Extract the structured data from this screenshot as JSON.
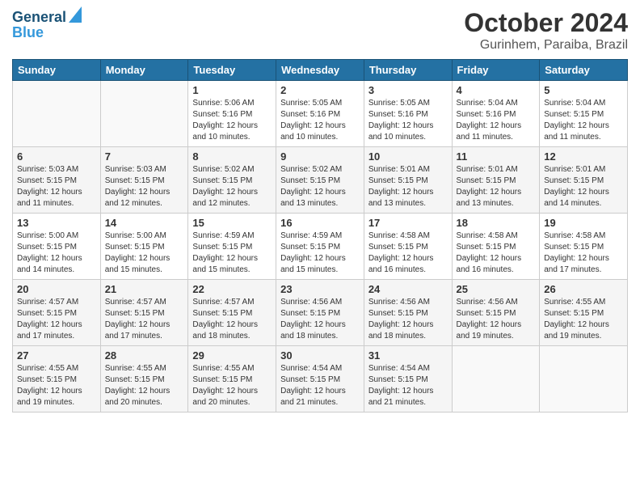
{
  "header": {
    "logo_line1": "General",
    "logo_line2": "Blue",
    "title": "October 2024",
    "subtitle": "Gurinhem, Paraiba, Brazil"
  },
  "days_of_week": [
    "Sunday",
    "Monday",
    "Tuesday",
    "Wednesday",
    "Thursday",
    "Friday",
    "Saturday"
  ],
  "weeks": [
    [
      {
        "day": "",
        "sunrise": "",
        "sunset": "",
        "daylight": ""
      },
      {
        "day": "",
        "sunrise": "",
        "sunset": "",
        "daylight": ""
      },
      {
        "day": "1",
        "sunrise": "Sunrise: 5:06 AM",
        "sunset": "Sunset: 5:16 PM",
        "daylight": "Daylight: 12 hours and 10 minutes."
      },
      {
        "day": "2",
        "sunrise": "Sunrise: 5:05 AM",
        "sunset": "Sunset: 5:16 PM",
        "daylight": "Daylight: 12 hours and 10 minutes."
      },
      {
        "day": "3",
        "sunrise": "Sunrise: 5:05 AM",
        "sunset": "Sunset: 5:16 PM",
        "daylight": "Daylight: 12 hours and 10 minutes."
      },
      {
        "day": "4",
        "sunrise": "Sunrise: 5:04 AM",
        "sunset": "Sunset: 5:16 PM",
        "daylight": "Daylight: 12 hours and 11 minutes."
      },
      {
        "day": "5",
        "sunrise": "Sunrise: 5:04 AM",
        "sunset": "Sunset: 5:15 PM",
        "daylight": "Daylight: 12 hours and 11 minutes."
      }
    ],
    [
      {
        "day": "6",
        "sunrise": "Sunrise: 5:03 AM",
        "sunset": "Sunset: 5:15 PM",
        "daylight": "Daylight: 12 hours and 11 minutes."
      },
      {
        "day": "7",
        "sunrise": "Sunrise: 5:03 AM",
        "sunset": "Sunset: 5:15 PM",
        "daylight": "Daylight: 12 hours and 12 minutes."
      },
      {
        "day": "8",
        "sunrise": "Sunrise: 5:02 AM",
        "sunset": "Sunset: 5:15 PM",
        "daylight": "Daylight: 12 hours and 12 minutes."
      },
      {
        "day": "9",
        "sunrise": "Sunrise: 5:02 AM",
        "sunset": "Sunset: 5:15 PM",
        "daylight": "Daylight: 12 hours and 13 minutes."
      },
      {
        "day": "10",
        "sunrise": "Sunrise: 5:01 AM",
        "sunset": "Sunset: 5:15 PM",
        "daylight": "Daylight: 12 hours and 13 minutes."
      },
      {
        "day": "11",
        "sunrise": "Sunrise: 5:01 AM",
        "sunset": "Sunset: 5:15 PM",
        "daylight": "Daylight: 12 hours and 13 minutes."
      },
      {
        "day": "12",
        "sunrise": "Sunrise: 5:01 AM",
        "sunset": "Sunset: 5:15 PM",
        "daylight": "Daylight: 12 hours and 14 minutes."
      }
    ],
    [
      {
        "day": "13",
        "sunrise": "Sunrise: 5:00 AM",
        "sunset": "Sunset: 5:15 PM",
        "daylight": "Daylight: 12 hours and 14 minutes."
      },
      {
        "day": "14",
        "sunrise": "Sunrise: 5:00 AM",
        "sunset": "Sunset: 5:15 PM",
        "daylight": "Daylight: 12 hours and 15 minutes."
      },
      {
        "day": "15",
        "sunrise": "Sunrise: 4:59 AM",
        "sunset": "Sunset: 5:15 PM",
        "daylight": "Daylight: 12 hours and 15 minutes."
      },
      {
        "day": "16",
        "sunrise": "Sunrise: 4:59 AM",
        "sunset": "Sunset: 5:15 PM",
        "daylight": "Daylight: 12 hours and 15 minutes."
      },
      {
        "day": "17",
        "sunrise": "Sunrise: 4:58 AM",
        "sunset": "Sunset: 5:15 PM",
        "daylight": "Daylight: 12 hours and 16 minutes."
      },
      {
        "day": "18",
        "sunrise": "Sunrise: 4:58 AM",
        "sunset": "Sunset: 5:15 PM",
        "daylight": "Daylight: 12 hours and 16 minutes."
      },
      {
        "day": "19",
        "sunrise": "Sunrise: 4:58 AM",
        "sunset": "Sunset: 5:15 PM",
        "daylight": "Daylight: 12 hours and 17 minutes."
      }
    ],
    [
      {
        "day": "20",
        "sunrise": "Sunrise: 4:57 AM",
        "sunset": "Sunset: 5:15 PM",
        "daylight": "Daylight: 12 hours and 17 minutes."
      },
      {
        "day": "21",
        "sunrise": "Sunrise: 4:57 AM",
        "sunset": "Sunset: 5:15 PM",
        "daylight": "Daylight: 12 hours and 17 minutes."
      },
      {
        "day": "22",
        "sunrise": "Sunrise: 4:57 AM",
        "sunset": "Sunset: 5:15 PM",
        "daylight": "Daylight: 12 hours and 18 minutes."
      },
      {
        "day": "23",
        "sunrise": "Sunrise: 4:56 AM",
        "sunset": "Sunset: 5:15 PM",
        "daylight": "Daylight: 12 hours and 18 minutes."
      },
      {
        "day": "24",
        "sunrise": "Sunrise: 4:56 AM",
        "sunset": "Sunset: 5:15 PM",
        "daylight": "Daylight: 12 hours and 18 minutes."
      },
      {
        "day": "25",
        "sunrise": "Sunrise: 4:56 AM",
        "sunset": "Sunset: 5:15 PM",
        "daylight": "Daylight: 12 hours and 19 minutes."
      },
      {
        "day": "26",
        "sunrise": "Sunrise: 4:55 AM",
        "sunset": "Sunset: 5:15 PM",
        "daylight": "Daylight: 12 hours and 19 minutes."
      }
    ],
    [
      {
        "day": "27",
        "sunrise": "Sunrise: 4:55 AM",
        "sunset": "Sunset: 5:15 PM",
        "daylight": "Daylight: 12 hours and 19 minutes."
      },
      {
        "day": "28",
        "sunrise": "Sunrise: 4:55 AM",
        "sunset": "Sunset: 5:15 PM",
        "daylight": "Daylight: 12 hours and 20 minutes."
      },
      {
        "day": "29",
        "sunrise": "Sunrise: 4:55 AM",
        "sunset": "Sunset: 5:15 PM",
        "daylight": "Daylight: 12 hours and 20 minutes."
      },
      {
        "day": "30",
        "sunrise": "Sunrise: 4:54 AM",
        "sunset": "Sunset: 5:15 PM",
        "daylight": "Daylight: 12 hours and 21 minutes."
      },
      {
        "day": "31",
        "sunrise": "Sunrise: 4:54 AM",
        "sunset": "Sunset: 5:15 PM",
        "daylight": "Daylight: 12 hours and 21 minutes."
      },
      {
        "day": "",
        "sunrise": "",
        "sunset": "",
        "daylight": ""
      },
      {
        "day": "",
        "sunrise": "",
        "sunset": "",
        "daylight": ""
      }
    ]
  ]
}
